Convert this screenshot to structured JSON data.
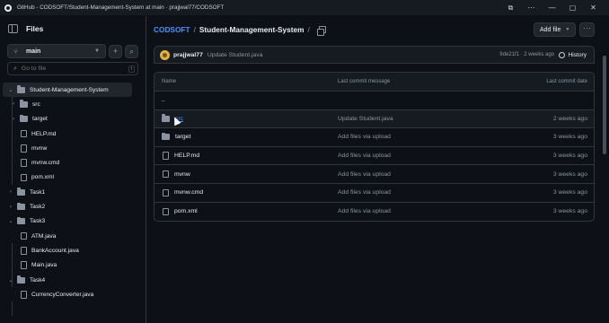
{
  "window": {
    "title": "GitHub - CODSOFT/Student-Management-System at main · prajjwal77/CODSOFT",
    "controls": [
      "⧉",
      "⋯",
      "—",
      "▢",
      "✕"
    ]
  },
  "sidebar": {
    "title": "Files",
    "branch": "main",
    "search_placeholder": "Go to file",
    "search_kbd": "t",
    "tree": [
      {
        "label": "Student-Management-System",
        "type": "folder",
        "depth": 0,
        "open": true,
        "selected": true
      },
      {
        "label": "src",
        "type": "folder",
        "depth": 1,
        "open": false
      },
      {
        "label": "target",
        "type": "folder",
        "depth": 1,
        "open": false
      },
      {
        "label": "HELP.md",
        "type": "file",
        "depth": 1
      },
      {
        "label": "mvnw",
        "type": "file",
        "depth": 1
      },
      {
        "label": "mvnw.cmd",
        "type": "file",
        "depth": 1
      },
      {
        "label": "pom.xml",
        "type": "file",
        "depth": 1
      },
      {
        "label": "Task1",
        "type": "folder",
        "depth": 0,
        "open": false
      },
      {
        "label": "Task2",
        "type": "folder",
        "depth": 0,
        "open": false
      },
      {
        "label": "Task3",
        "type": "folder",
        "depth": 0,
        "open": true
      },
      {
        "label": "ATM.java",
        "type": "file",
        "depth": 1
      },
      {
        "label": "BankAccount.java",
        "type": "file",
        "depth": 1
      },
      {
        "label": "Main.java",
        "type": "file",
        "depth": 1
      },
      {
        "label": "Task4",
        "type": "folder",
        "depth": 0,
        "open": true
      },
      {
        "label": "CurrencyConverter.java",
        "type": "file",
        "depth": 1
      }
    ]
  },
  "breadcrumb": {
    "owner": "CODSOFT",
    "separator": "/",
    "repo": "Student-Management-System",
    "trailing": "/"
  },
  "actions": {
    "add_file": "Add file",
    "more": "···"
  },
  "latest_commit": {
    "author": "prajjwal77",
    "message": "Update Student.java",
    "meta": "9de21f1 · 2 weeks ago",
    "history": "History"
  },
  "table": {
    "headers": {
      "name": "Name",
      "commit": "Last commit message",
      "date": "Last commit date"
    },
    "rows": [
      {
        "name": "..",
        "type": "parent",
        "commit": "",
        "date": ""
      },
      {
        "name": "src",
        "type": "folder",
        "commit": "Update Student.java",
        "date": "2 weeks ago",
        "hover": true
      },
      {
        "name": "target",
        "type": "folder",
        "commit": "Add files via upload",
        "date": "3 weeks ago"
      },
      {
        "name": "HELP.md",
        "type": "file",
        "commit": "Add files via upload",
        "date": "3 weeks ago"
      },
      {
        "name": "mvnw",
        "type": "file",
        "commit": "Add files via upload",
        "date": "3 weeks ago"
      },
      {
        "name": "mvnw.cmd",
        "type": "file",
        "commit": "Add files via upload",
        "date": "3 weeks ago"
      },
      {
        "name": "pom.xml",
        "type": "file",
        "commit": "Add files via upload",
        "date": "3 weeks ago"
      }
    ]
  }
}
